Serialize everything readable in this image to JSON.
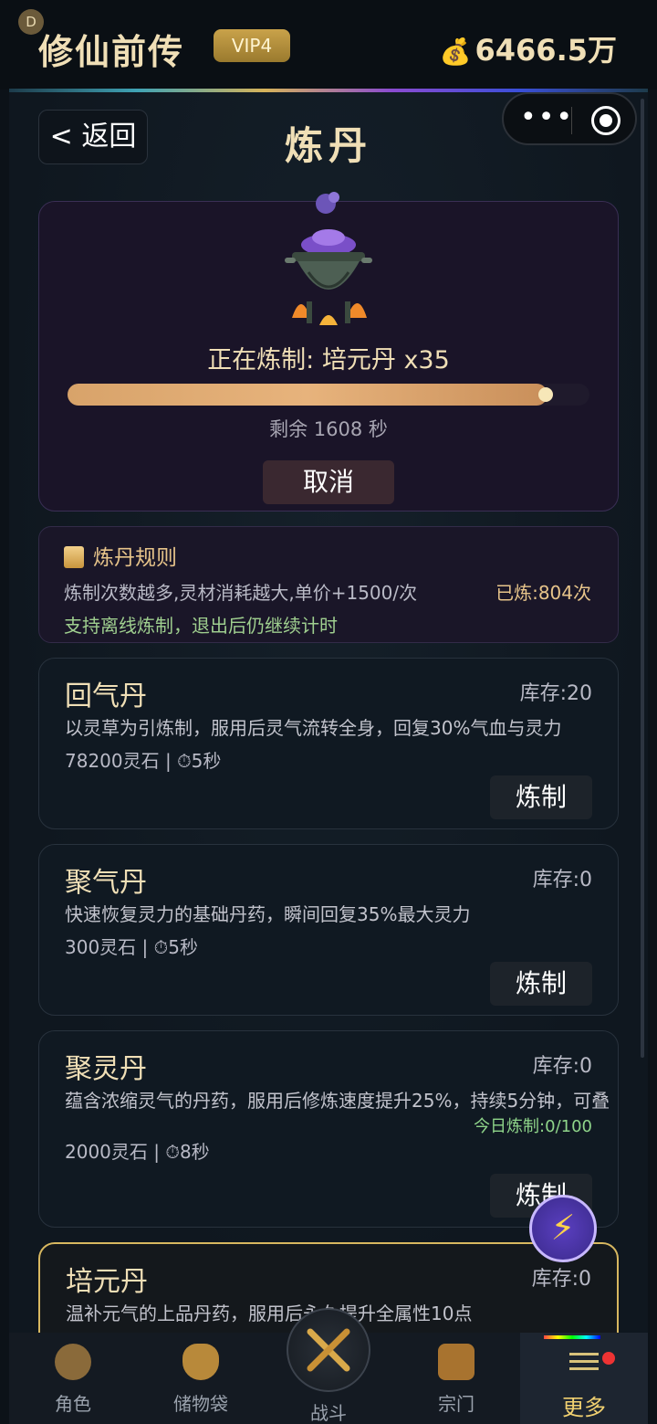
{
  "topbar": {
    "badge": "D",
    "title": "修仙前传",
    "vip": "VIP4",
    "money": "6466.5万"
  },
  "header": {
    "back_label": "< 返回",
    "title": "炼丹"
  },
  "alchemy": {
    "crafting_text": "正在炼制: 培元丹 x35",
    "progress_fraction": 0.92,
    "remain_text": "剩余 1608 秒",
    "cancel_label": "取消"
  },
  "rules": {
    "title": "炼丹规则",
    "line1": "炼制次数越多,灵材消耗越大,单价+1500/次",
    "count": "已炼:804次",
    "line2": "支持离线炼制，退出后仍继续计时"
  },
  "pills": [
    {
      "name": "回气丹",
      "stock": "库存:20",
      "desc": "以灵草为引炼制，服用后灵气流转全身，回复30%气血与灵力",
      "cost": "78200灵石 | ⏱5秒",
      "daily": "",
      "button": "炼制"
    },
    {
      "name": "聚气丹",
      "stock": "库存:0",
      "desc": "快速恢复灵力的基础丹药，瞬间回复35%最大灵力",
      "cost": "300灵石 | ⏱5秒",
      "daily": "",
      "button": "炼制"
    },
    {
      "name": "聚灵丹",
      "stock": "库存:0",
      "desc": "蕴含浓缩灵气的丹药，服用后修炼速度提升25%，持续5分钟，可叠",
      "cost": "2000灵石 | ⏱8秒",
      "daily": "今日炼制:0/100",
      "button": "炼制"
    },
    {
      "name": "培元丹",
      "stock": "库存:0",
      "desc": "温补元气的上品丹药，服用后永久提升全属性10点",
      "cost": "",
      "daily": "",
      "button": ""
    }
  ],
  "bolt": "⚡",
  "nav": {
    "items": [
      {
        "label": "角色",
        "icon": "character-icon"
      },
      {
        "label": "储物袋",
        "icon": "bag-icon"
      },
      {
        "label": "战斗",
        "icon": "swords-icon"
      },
      {
        "label": "宗门",
        "icon": "sect-icon"
      },
      {
        "label": "更多",
        "icon": "menu-icon"
      }
    ]
  },
  "colors": {
    "gold_text": "#f0dfb6",
    "green_text": "#9fcf8f",
    "accent_yellow": "#f0d070",
    "progress": "#e7b37c"
  }
}
